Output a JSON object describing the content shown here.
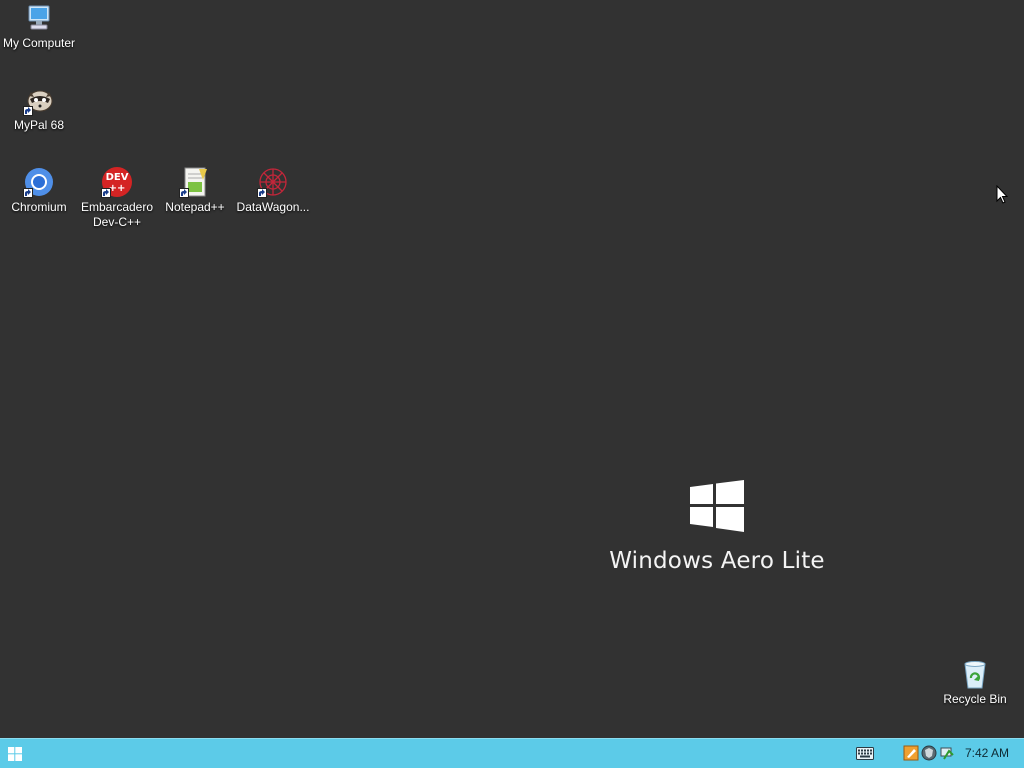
{
  "desktop": {
    "icons": [
      {
        "name": "my-computer",
        "label": "My Computer"
      },
      {
        "name": "mypal",
        "label": "MyPal 68"
      },
      {
        "name": "chromium",
        "label": "Chromium"
      },
      {
        "name": "devcpp",
        "label": "Embarcadero Dev-C++",
        "badge": "DEV ++"
      },
      {
        "name": "notepadpp",
        "label": "Notepad++"
      },
      {
        "name": "datawagon",
        "label": "DataWagon..."
      },
      {
        "name": "recycle-bin",
        "label": "Recycle Bin"
      }
    ],
    "background_color": "#323232"
  },
  "branding": {
    "text": "Windows Aero Lite",
    "logo_icon": "windows-logo-icon"
  },
  "taskbar": {
    "color": "#5ccbe8",
    "start_icon": "windows-start-icon",
    "tray": {
      "icons": [
        "keyboard-icon",
        "notepad-tray-icon",
        "security-shield-icon",
        "network-icon"
      ],
      "clock": "7:42 AM"
    }
  }
}
